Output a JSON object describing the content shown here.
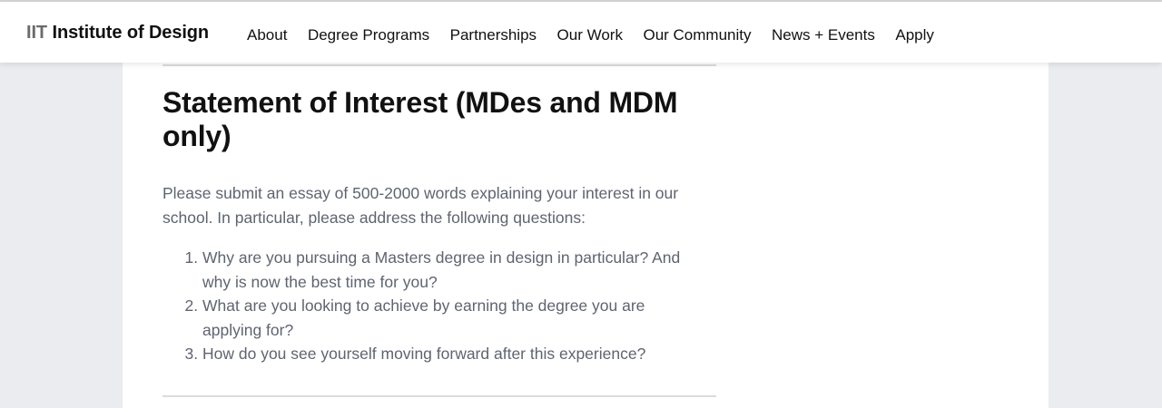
{
  "header": {
    "logo_prefix": "IIT",
    "logo_name": "Institute of Design",
    "nav": [
      "About",
      "Degree Programs",
      "Partnerships",
      "Our Work",
      "Our Community",
      "News + Events",
      "Apply"
    ]
  },
  "section": {
    "title": "Statement of Interest (MDes and MDM only)",
    "intro": "Please submit an essay of 500-2000 words explaining your interest in our school. In particular, please address the following questions:",
    "questions": [
      "Why are you pursuing a Masters degree in design in particular? And why is now the best time for you?",
      "What are you looking to achieve by earning the degree you are applying for?",
      "How do you see yourself moving forward after this experience?"
    ]
  }
}
